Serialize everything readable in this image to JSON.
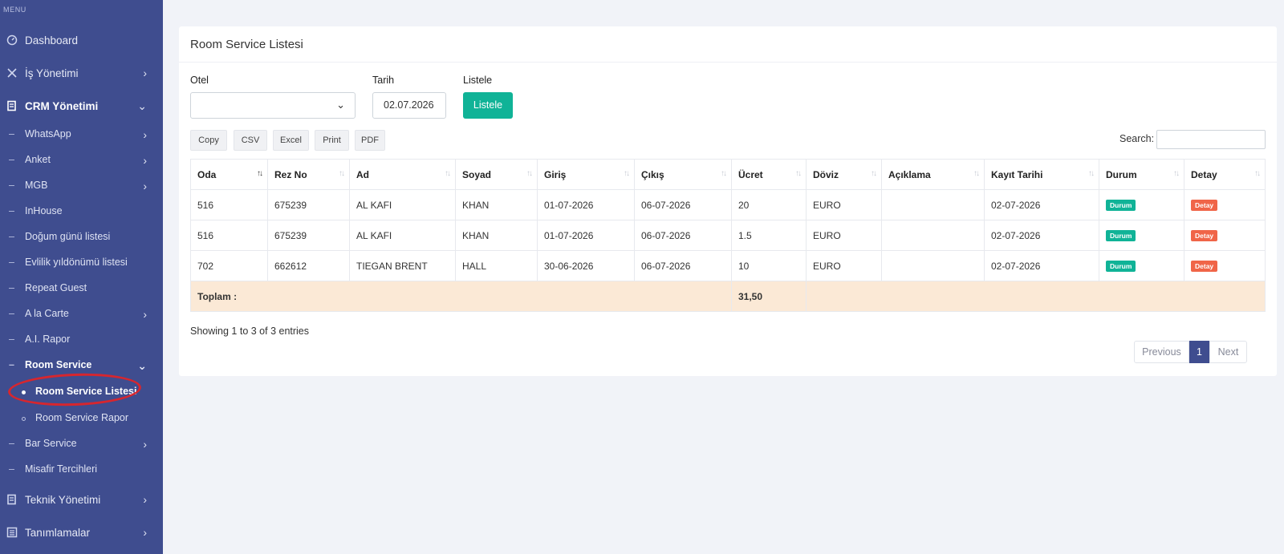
{
  "sidebar": {
    "menu_heading": "MENU",
    "items": [
      {
        "label": "Dashboard"
      },
      {
        "label": "İş Yönetimi"
      },
      {
        "label": "CRM Yönetimi"
      },
      {
        "label": "Teknik Yönetimi"
      },
      {
        "label": "Tanımlamalar"
      }
    ],
    "crm_sub": [
      {
        "label": "WhatsApp"
      },
      {
        "label": "Anket"
      },
      {
        "label": "MGB"
      },
      {
        "label": "InHouse"
      },
      {
        "label": "Doğum günü listesi"
      },
      {
        "label": "Evlilik yıldönümü listesi"
      },
      {
        "label": "Repeat Guest"
      },
      {
        "label": "A la Carte"
      },
      {
        "label": "A.I. Rapor"
      },
      {
        "label": "Room Service"
      },
      {
        "label": "Bar Service"
      },
      {
        "label": "Misafir Tercihleri"
      }
    ],
    "room_service_sub": [
      {
        "label": "Room Service Listesi"
      },
      {
        "label": "Room Service Rapor"
      }
    ],
    "highlight_color": "#d7262e"
  },
  "page": {
    "title": "Room Service Listesi",
    "filters": {
      "otel_label": "Otel",
      "otel_value": "",
      "tarih_label": "Tarih",
      "tarih_value": "02.07.2026",
      "listele_label": "Listele",
      "listele_button": "Listele"
    },
    "toolbar": {
      "copy": "Copy",
      "csv": "CSV",
      "excel": "Excel",
      "print": "Print",
      "pdf": "PDF",
      "search_label": "Search:"
    },
    "table": {
      "columns": [
        "Oda",
        "Rez No",
        "Ad",
        "Soyad",
        "Giriş",
        "Çıkış",
        "Ücret",
        "Döviz",
        "Açıklama",
        "Kayıt Tarihi",
        "Durum",
        "Detay"
      ],
      "rows": [
        [
          "516",
          "675239",
          "AL KAFI",
          "KHAN",
          "01-07-2026",
          "06-07-2026",
          "20",
          "EURO",
          "",
          "02-07-2026",
          "Durum",
          "Detay"
        ],
        [
          "516",
          "675239",
          "AL KAFI",
          "KHAN",
          "01-07-2026",
          "06-07-2026",
          "1.5",
          "EURO",
          "",
          "02-07-2026",
          "Durum",
          "Detay"
        ],
        [
          "702",
          "662612",
          "TIEGAN BRENT",
          "HALL",
          "30-06-2026",
          "06-07-2026",
          "10",
          "EURO",
          "",
          "02-07-2026",
          "Durum",
          "Detay"
        ]
      ],
      "total_label": "Toplam :",
      "total_value": "31,50"
    },
    "showing": "Showing 1 to 3 of 3 entries",
    "pagination": {
      "previous": "Previous",
      "current": "1",
      "next": "Next"
    }
  },
  "colors": {
    "sidebar_bg": "#3f4d8f",
    "accent_green": "#10b397",
    "badge_red": "#f06548",
    "total_row_bg": "#fbe9d6"
  }
}
